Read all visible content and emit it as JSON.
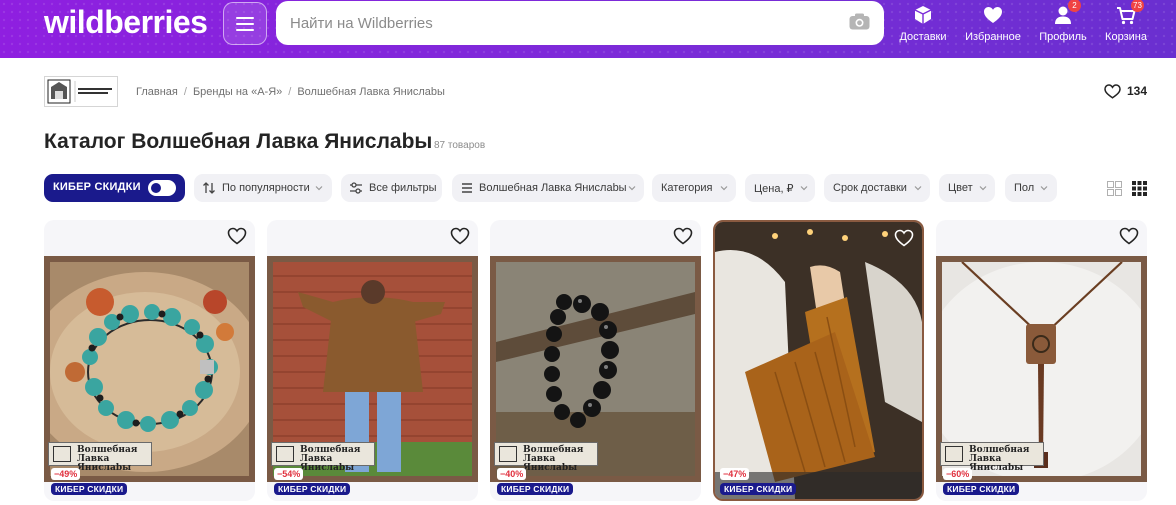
{
  "header": {
    "logo": "wildberries",
    "search_placeholder": "Найти на Wildberries",
    "nav": [
      {
        "label": "Доставки",
        "icon": "box-icon"
      },
      {
        "label": "Избранное",
        "icon": "heart-icon"
      },
      {
        "label": "Профиль",
        "icon": "user-icon",
        "badge": "2"
      },
      {
        "label": "Корзина",
        "icon": "cart-icon",
        "badge": "73"
      }
    ]
  },
  "breadcrumb": [
    "Главная",
    "Бренды на «А-Я»",
    "Волшебная Лавка Янислаbы"
  ],
  "brand": {
    "favorites_count": "134"
  },
  "catalog": {
    "title": "Каталог Волшебная Лавка Янислаbы",
    "count": "87 товаров"
  },
  "filters": {
    "cyber": "КИБЕР СКИДКИ",
    "sort": "По популярности",
    "all": "Все фильтры",
    "brand": "Волшебная Лавка Янислаbы",
    "category": "Категория",
    "price": "Цена, ₽",
    "delivery": "Срок доставки",
    "color": "Цвет",
    "gender": "Пол"
  },
  "products": [
    {
      "discount": "−49%",
      "badge": "КИБЕР СКИДКИ",
      "stamp": "Волшебная Лавка Янислаbы",
      "kind": "bracelet-turquoise"
    },
    {
      "discount": "−54%",
      "badge": "КИБЕР СКИДКИ",
      "stamp": "Волшебная Лавка Янислаbы",
      "kind": "sweater"
    },
    {
      "discount": "−40%",
      "badge": "КИБЕР СКИДКИ",
      "stamp": "Волшебная Лавка Янислаbы",
      "kind": "bracelet-black"
    },
    {
      "discount": "−47%",
      "badge": "КИБЕР СКИДКИ",
      "stamp": "",
      "kind": "leg-warmers"
    },
    {
      "discount": "−60%",
      "badge": "КИБЕР СКИДКИ",
      "stamp": "Волшебная Лавка Янислаbы",
      "kind": "pendant"
    }
  ],
  "colors": {
    "header": "#7b2bd8",
    "cyber": "#1a1a8c",
    "discount": "#e0303e"
  }
}
